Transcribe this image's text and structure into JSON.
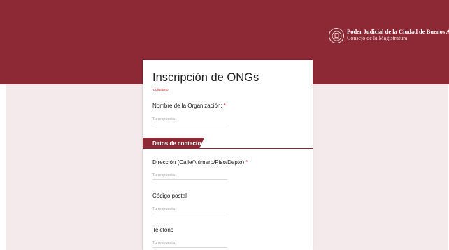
{
  "header": {
    "org_title": "Poder Judicial de la Ciudad de Buenos Aires",
    "org_subtitle": "Consejo de la Magistratura"
  },
  "form": {
    "title": "Inscripción de ONGs",
    "required_note": "*Obligatorio",
    "answer_placeholder": "Tu respuesta",
    "questions": [
      {
        "label": "Nombre de la Organización:",
        "required": "*"
      },
      {
        "label": "Dirección (Calle/Número/Piso/Depto)",
        "required": "*"
      },
      {
        "label": "Código postal"
      },
      {
        "label": "Teléfono"
      }
    ],
    "section": {
      "title": "Datos de contacto"
    }
  },
  "colors": {
    "brand": "#8d2835",
    "background": "#f5eaeb",
    "required": "#d32f2f"
  },
  "icons": {
    "seal": "judiciary-seal-icon"
  }
}
